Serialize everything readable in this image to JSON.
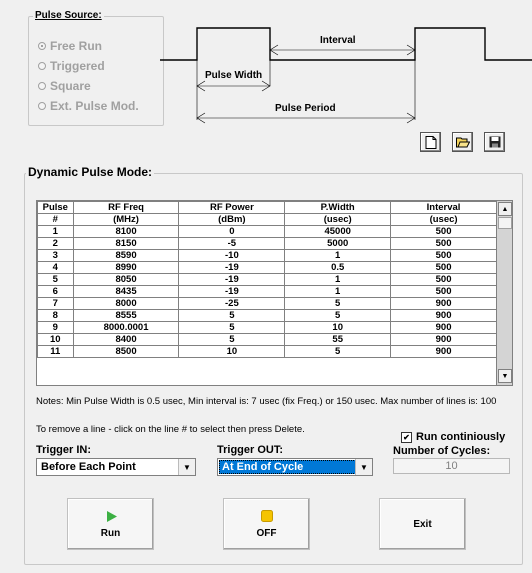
{
  "pulse_source": {
    "title": "Pulse Source:",
    "options": [
      {
        "label": "Free Run",
        "checked": true
      },
      {
        "label": "Triggered",
        "checked": false
      },
      {
        "label": "Square",
        "checked": false
      },
      {
        "label": "Ext. Pulse Mod.",
        "checked": false
      }
    ]
  },
  "waveform": {
    "interval_label": "Interval",
    "pulse_width_label": "Pulse Width",
    "pulse_period_label": "Pulse Period"
  },
  "toolbar": {
    "new_icon": "new-file-icon",
    "open_icon": "open-folder-icon",
    "save_icon": "save-disk-icon"
  },
  "dynamic": {
    "title": "Dynamic Pulse Mode:",
    "columns": [
      {
        "h1": "Pulse",
        "h2": "#"
      },
      {
        "h1": "RF Freq",
        "h2": "(MHz)"
      },
      {
        "h1": "RF Power",
        "h2": "(dBm)"
      },
      {
        "h1": "P.Width",
        "h2": "(usec)"
      },
      {
        "h1": "Interval",
        "h2": "(usec)"
      }
    ],
    "rows": [
      [
        "1",
        "8100",
        "0",
        "45000",
        "500"
      ],
      [
        "2",
        "8150",
        "-5",
        "5000",
        "500"
      ],
      [
        "3",
        "8590",
        "-10",
        "1",
        "500"
      ],
      [
        "4",
        "8990",
        "-19",
        "0.5",
        "500"
      ],
      [
        "5",
        "8050",
        "-19",
        "1",
        "500"
      ],
      [
        "6",
        "8435",
        "-19",
        "1",
        "500"
      ],
      [
        "7",
        "8000",
        "-25",
        "5",
        "900"
      ],
      [
        "8",
        "8555",
        "5",
        "5",
        "900"
      ],
      [
        "9",
        "8000.0001",
        "5",
        "10",
        "900"
      ],
      [
        "10",
        "8400",
        "5",
        "55",
        "900"
      ],
      [
        "11",
        "8500",
        "10",
        "5",
        "900"
      ]
    ],
    "notes": "Notes: Min Pulse Width is 0.5 usec, Min interval is: 7 usec (fix Freq.) or 150 usec. Max number of lines is: 100",
    "remove_hint": "To remove a line - click on the line # to select then press Delete.",
    "trigger_in_label": "Trigger IN:",
    "trigger_in_value": "Before Each Point",
    "trigger_out_label": "Trigger OUT:",
    "trigger_out_value": "At End of Cycle",
    "run_continuously_label": "Run continiously",
    "run_continuously_checked": true,
    "cycles_label": "Number of Cycles:",
    "cycles_value": "10"
  },
  "buttons": {
    "run_label": "Run",
    "off_label": "OFF",
    "exit_label": "Exit"
  },
  "colors": {
    "run_icon": "#3cb043",
    "off_icon": "#f5c400",
    "selection": "#0078d7"
  }
}
